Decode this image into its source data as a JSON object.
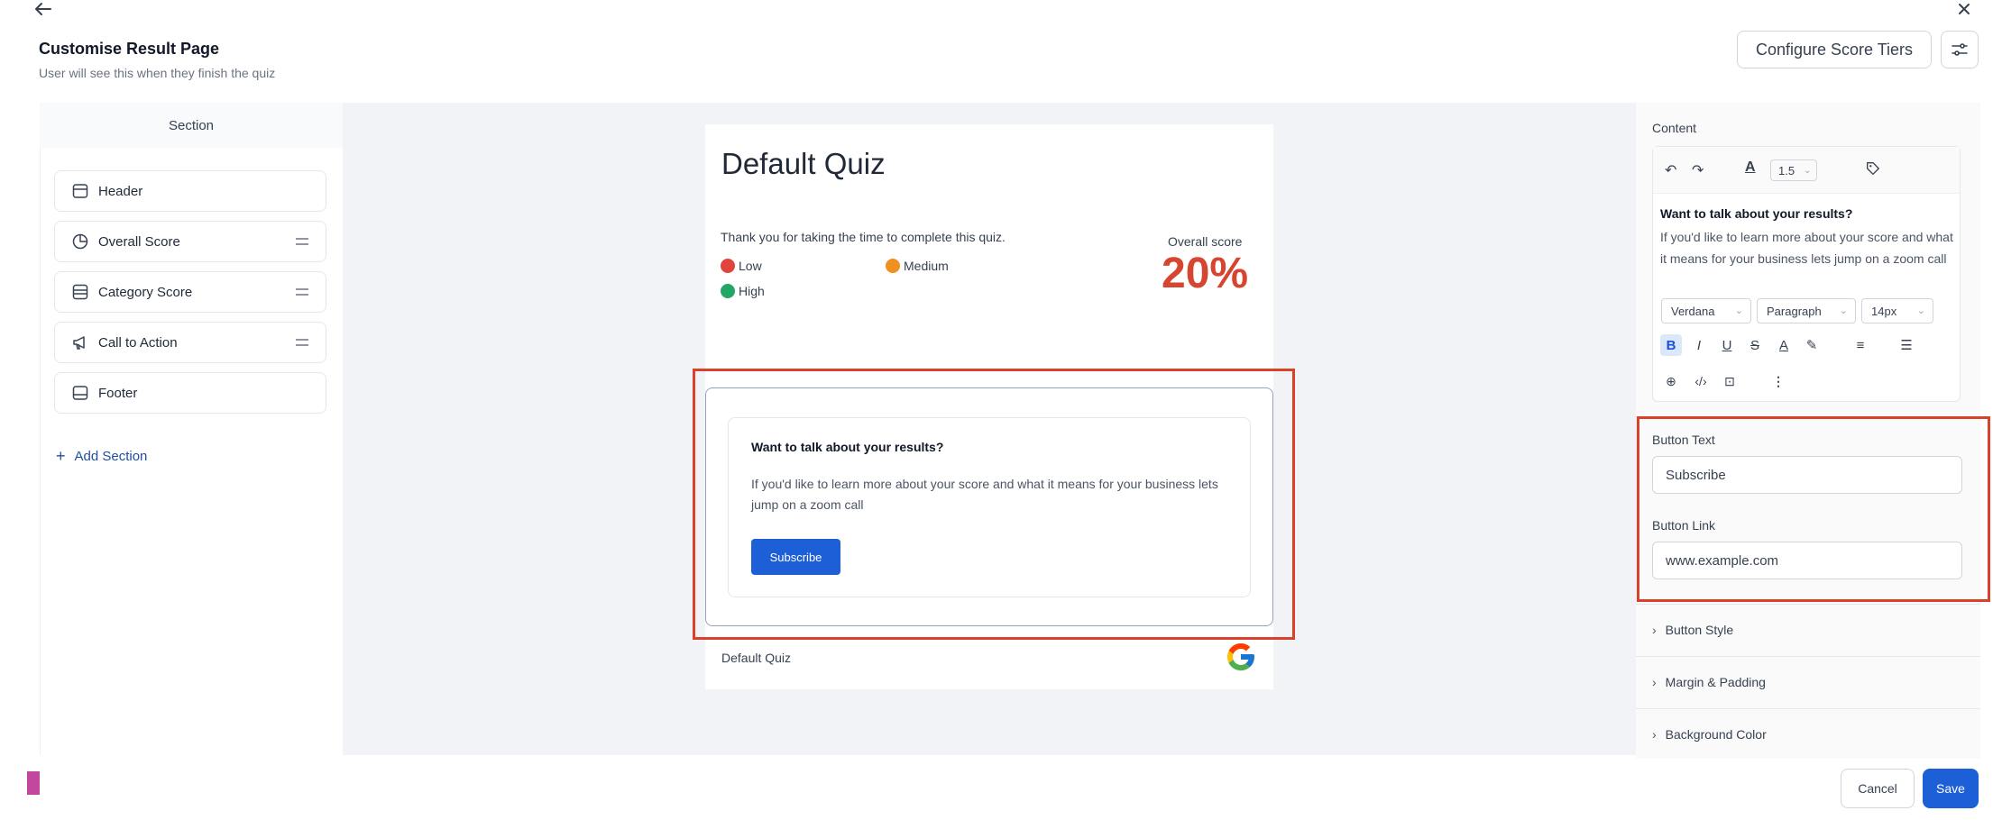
{
  "header": {
    "title": "Customise Result Page",
    "subtitle": "User will see this when they finish the quiz",
    "configure_label": "Configure Score Tiers"
  },
  "sidebar": {
    "heading": "Section",
    "items": [
      {
        "label": "Header",
        "icon": "layout-header-icon"
      },
      {
        "label": "Overall Score",
        "icon": "pie-chart-icon"
      },
      {
        "label": "Category Score",
        "icon": "list-box-icon"
      },
      {
        "label": "Call to Action",
        "icon": "megaphone-icon"
      },
      {
        "label": "Footer",
        "icon": "layout-footer-icon"
      }
    ],
    "add_label": "Add Section"
  },
  "preview": {
    "quiz_title": "Default Quiz",
    "thanks_text": "Thank you for taking the time to complete this quiz.",
    "legend": [
      {
        "label": "Low",
        "color": "#e0443a"
      },
      {
        "label": "Medium",
        "color": "#f0901e"
      },
      {
        "label": "High",
        "color": "#22a663"
      }
    ],
    "score_label": "Overall score",
    "score_value": "20%",
    "score_color": "#d64530",
    "cta": {
      "heading": "Want to talk about your results?",
      "body": "If you'd like to learn more about your score and what it means for your business lets jump on a zoom call",
      "button_label": "Subscribe"
    },
    "footer_text": "Default Quiz"
  },
  "panel": {
    "content_label": "Content",
    "line_height": "1.5",
    "editor_heading": "Want to talk about your results?",
    "editor_body": "If you'd like to learn more about your score and what it means for your business lets jump on a zoom call",
    "font_family": "Verdana",
    "block_type": "Paragraph",
    "font_size": "14px",
    "button_text_label": "Button Text",
    "button_text_value": "Subscribe",
    "button_link_label": "Button Link",
    "button_link_value": "www.example.com",
    "accordions": [
      "Button Style",
      "Margin & Padding",
      "Background Color"
    ]
  },
  "footer": {
    "cancel_label": "Cancel",
    "save_label": "Save"
  },
  "colors": {
    "accent": "#1d5fd6",
    "highlight": "#d9412b"
  }
}
